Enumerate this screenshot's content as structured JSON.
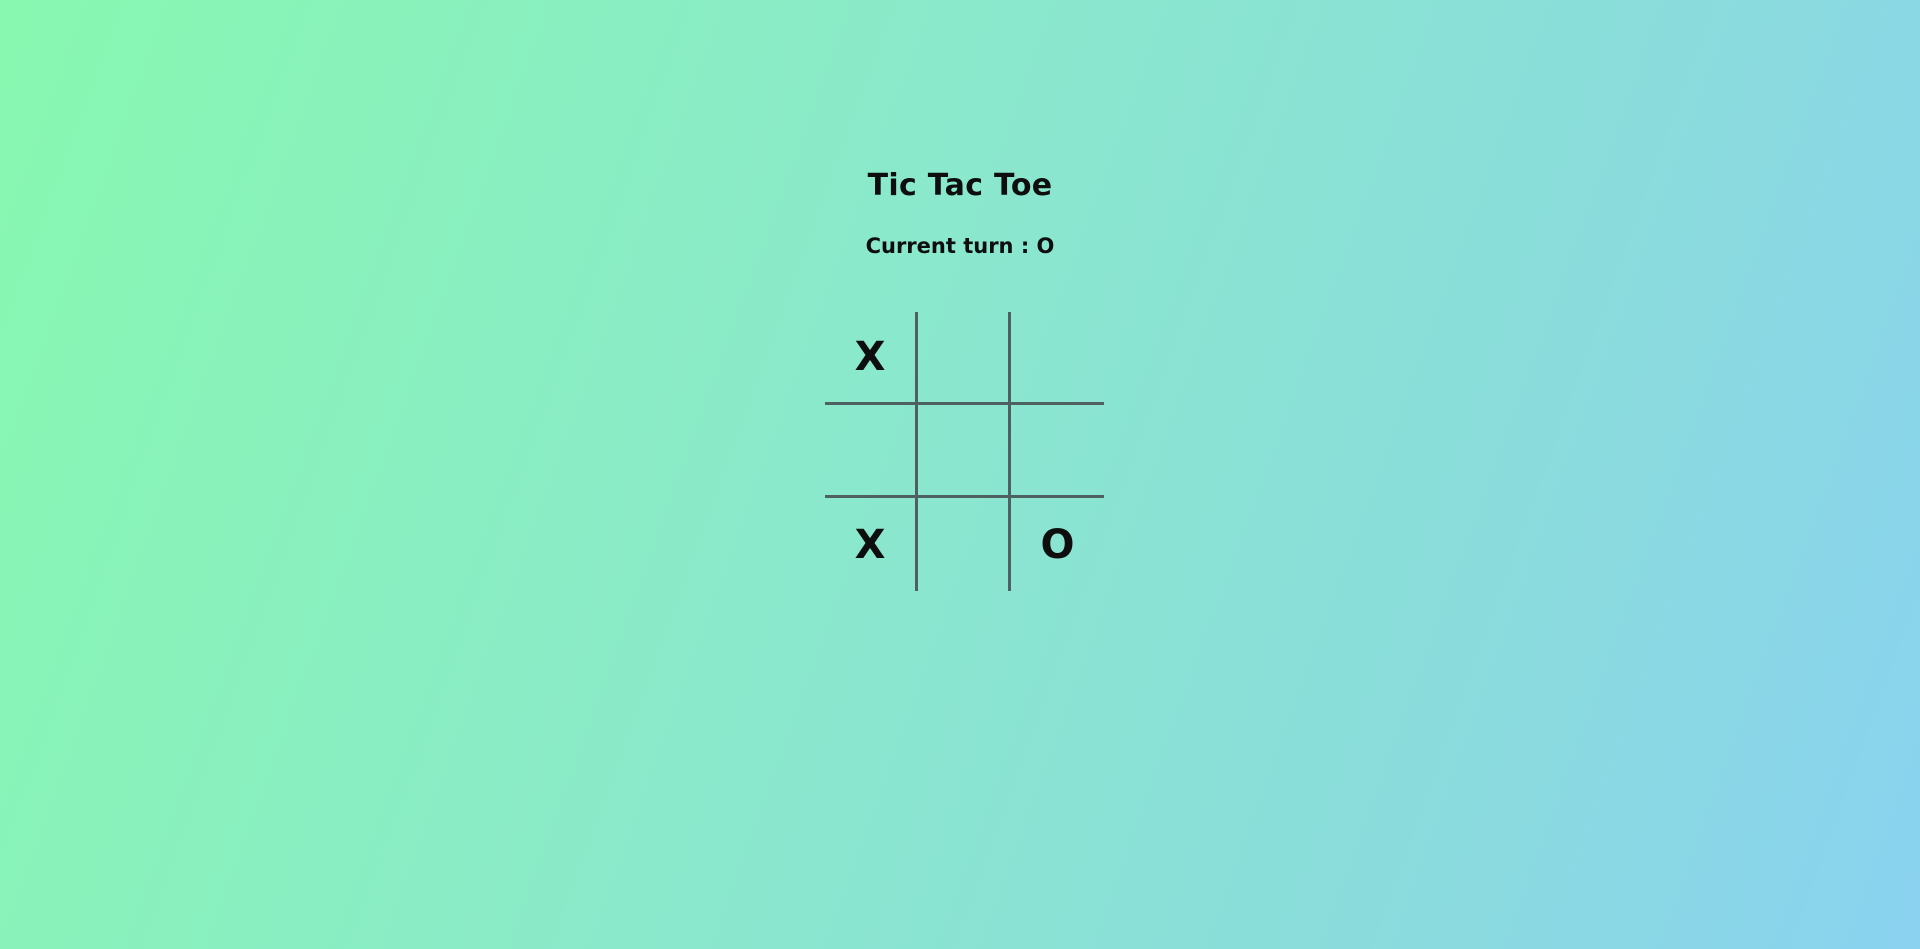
{
  "game": {
    "title": "Tic Tac Toe",
    "turn_text": "Current turn : O",
    "grid_color": "#4f6060",
    "board": [
      [
        "X",
        "",
        ""
      ],
      [
        "",
        "",
        ""
      ],
      [
        "X",
        "",
        "O"
      ]
    ]
  }
}
